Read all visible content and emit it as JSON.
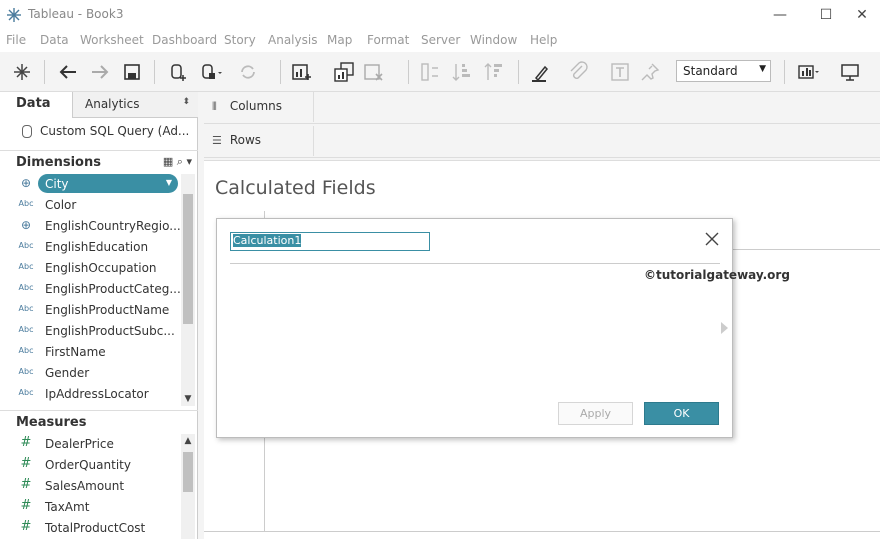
{
  "window": {
    "title": "Tableau - Book3",
    "minimize": "—",
    "maximize": "☐",
    "close": "✕"
  },
  "menu": [
    "File",
    "Data",
    "Worksheet",
    "Dashboard",
    "Story",
    "Analysis",
    "Map",
    "Format",
    "Server",
    "Window",
    "Help"
  ],
  "toolbar": {
    "fit_value": "Standard"
  },
  "left_panel": {
    "tab_data": "Data",
    "tab_analytics": "Analytics",
    "datasource": "Custom SQL Query (Ad...",
    "dimensions_label": "Dimensions",
    "dimensions": [
      {
        "type": "geo",
        "name": "City",
        "selected": true
      },
      {
        "type": "Abc",
        "name": "Color"
      },
      {
        "type": "geo",
        "name": "EnglishCountryRegio..."
      },
      {
        "type": "Abc",
        "name": "EnglishEducation"
      },
      {
        "type": "Abc",
        "name": "EnglishOccupation"
      },
      {
        "type": "Abc",
        "name": "EnglishProductCateg..."
      },
      {
        "type": "Abc",
        "name": "EnglishProductName"
      },
      {
        "type": "Abc",
        "name": "EnglishProductSubc..."
      },
      {
        "type": "Abc",
        "name": "FirstName"
      },
      {
        "type": "Abc",
        "name": "Gender"
      },
      {
        "type": "Abc",
        "name": "IpAddressLocator"
      }
    ],
    "measures_label": "Measures",
    "measures": [
      {
        "type": "#",
        "name": "DealerPrice"
      },
      {
        "type": "#",
        "name": "OrderQuantity"
      },
      {
        "type": "#",
        "name": "SalesAmount"
      },
      {
        "type": "#",
        "name": "TaxAmt"
      },
      {
        "type": "#",
        "name": "TotalProductCost"
      }
    ]
  },
  "shelves": {
    "columns": "Columns",
    "rows": "Rows"
  },
  "canvas": {
    "title": "Calculated Fields"
  },
  "dialog": {
    "name_value": "Calculation1",
    "watermark": "©tutorialgateway.org",
    "apply_label": "Apply",
    "ok_label": "OK"
  },
  "colors": {
    "accent": "#3a8fa4"
  }
}
